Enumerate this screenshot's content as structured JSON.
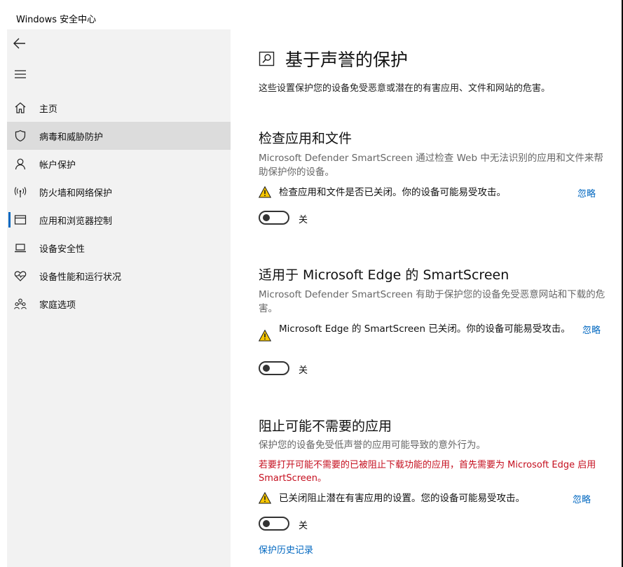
{
  "window": {
    "title": "Windows 安全中心"
  },
  "sidebar": {
    "items": [
      {
        "label": "主页",
        "icon": "home-icon"
      },
      {
        "label": "病毒和威胁防护",
        "icon": "shield-icon"
      },
      {
        "label": "帐户保护",
        "icon": "person-icon"
      },
      {
        "label": "防火墙和网络保护",
        "icon": "wireless-icon"
      },
      {
        "label": "应用和浏览器控制",
        "icon": "app-window-icon"
      },
      {
        "label": "设备安全性",
        "icon": "laptop-icon"
      },
      {
        "label": "设备性能和运行状况",
        "icon": "heart-pulse-icon"
      },
      {
        "label": "家庭选项",
        "icon": "family-icon"
      }
    ],
    "hovered_index": 1,
    "selected_index": 4
  },
  "page": {
    "title": "基于声誉的保护",
    "subtitle": "这些设置保护您的设备免受恶意或潜在的有害应用、文件和网站的危害。"
  },
  "sections": [
    {
      "title": "检查应用和文件",
      "description": "Microsoft Defender SmartScreen 通过检查 Web 中无法识别的应用和文件来帮助保护你的设备。",
      "warning": "检查应用和文件是否已关闭。你的设备可能易受攻击。",
      "ignore_label": "忽略",
      "toggle_state": "关"
    },
    {
      "title": "适用于 Microsoft Edge 的 SmartScreen",
      "description": "Microsoft Defender SmartScreen 有助于保护您的设备免受恶意网站和下载的危害。",
      "warning": "Microsoft Edge 的 SmartScreen 已关闭。你的设备可能易受攻击。",
      "ignore_label": "忽略",
      "toggle_state": "关"
    },
    {
      "title": "阻止可能不需要的应用",
      "description": "保护您的设备免受低声誉的应用可能导致的意外行为。",
      "note": "若要打开可能不需要的已被阻止下载功能的应用，首先需要为 Microsoft Edge 启用 SmartScreen。",
      "warning": "已关闭阻止潜在有害应用的设置。您的设备可能易受攻击。",
      "ignore_label": "忽略",
      "toggle_state": "关",
      "link_label": "保护历史记录"
    }
  ],
  "colors": {
    "accent": "#0067c0",
    "warning": "#f7c600",
    "error_text": "#c50f1f",
    "sidebar_bg": "#f2f2f2"
  }
}
